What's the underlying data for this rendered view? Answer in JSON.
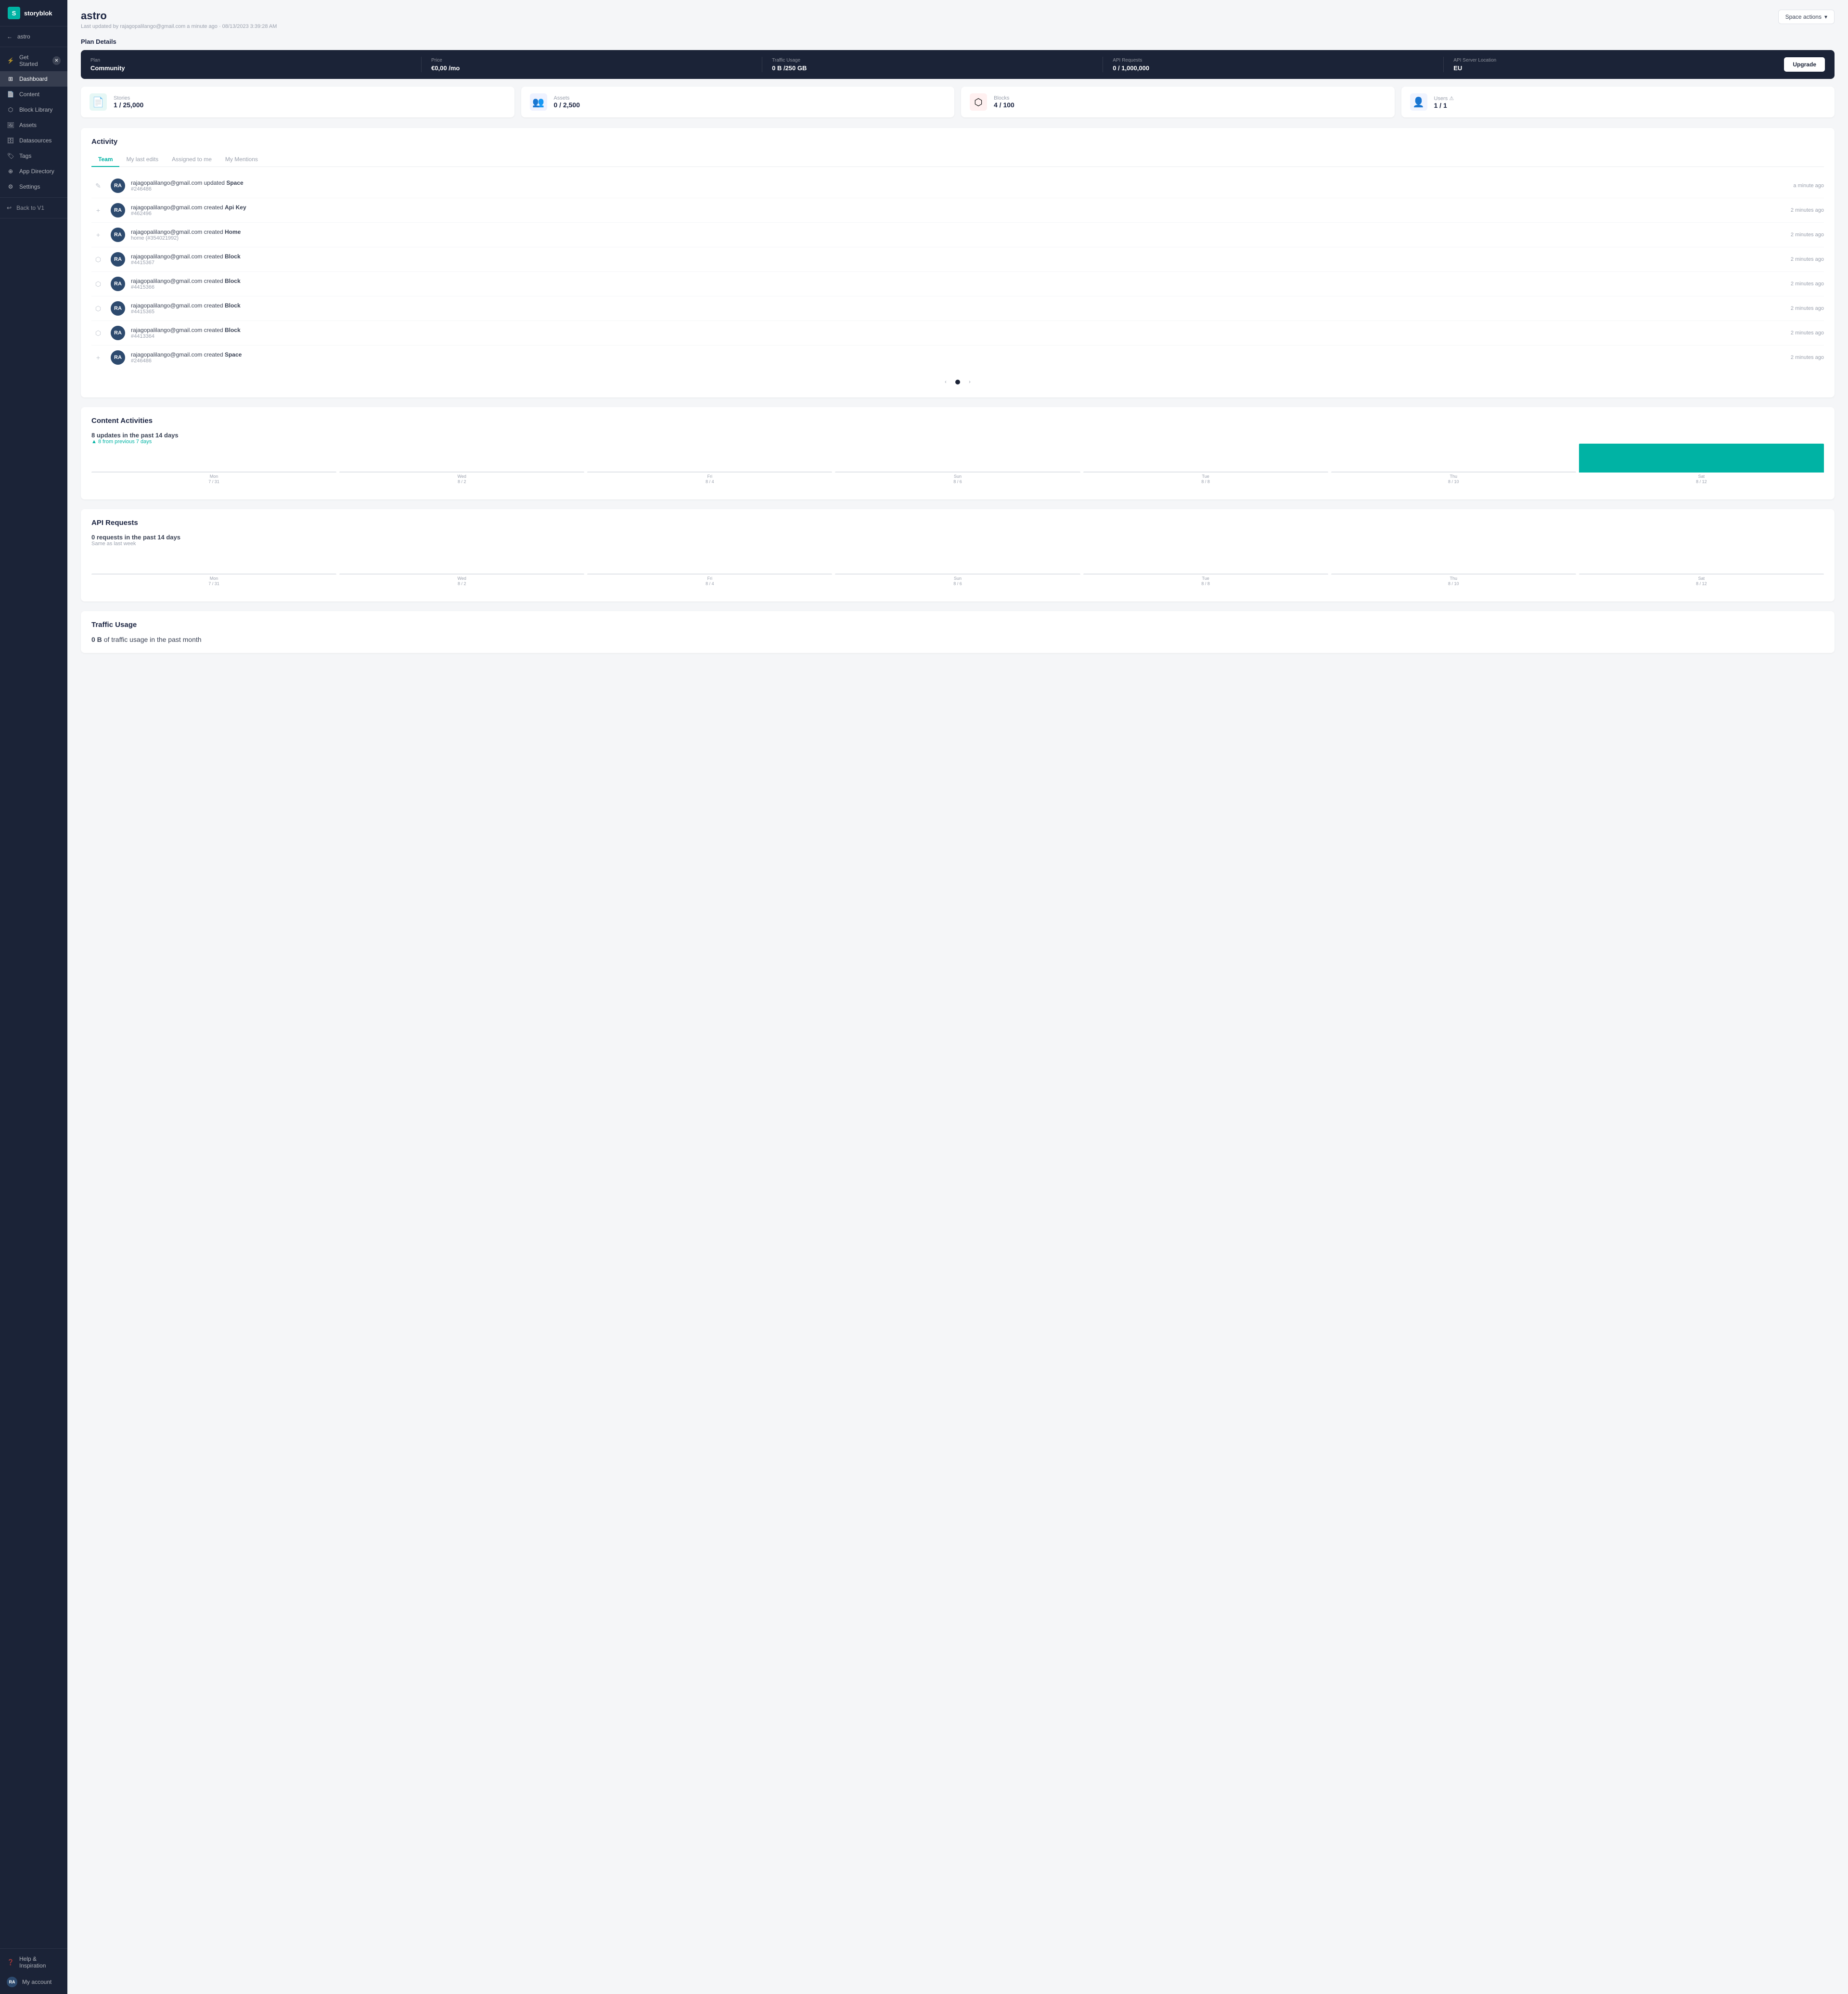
{
  "app": {
    "name": "storyblok"
  },
  "sidebar": {
    "space": "astro",
    "items": [
      {
        "id": "get-started",
        "label": "Get Started",
        "icon": "⚡",
        "active": false,
        "closeable": true
      },
      {
        "id": "dashboard",
        "label": "Dashboard",
        "icon": "🏠",
        "active": true
      },
      {
        "id": "content",
        "label": "Content",
        "icon": "📄",
        "active": false
      },
      {
        "id": "block-library",
        "label": "Block Library",
        "icon": "🧩",
        "active": false
      },
      {
        "id": "assets",
        "label": "Assets",
        "icon": "🖼",
        "active": false
      },
      {
        "id": "datasources",
        "label": "Datasources",
        "icon": "🗄",
        "active": false
      },
      {
        "id": "tags",
        "label": "Tags",
        "icon": "🏷",
        "active": false
      },
      {
        "id": "app-directory",
        "label": "App Directory",
        "icon": "📦",
        "active": false
      },
      {
        "id": "settings",
        "label": "Settings",
        "icon": "⚙",
        "active": false
      }
    ],
    "bottom_items": [
      {
        "id": "help",
        "label": "Help & Inspiration",
        "icon": "❓"
      },
      {
        "id": "account",
        "label": "My account",
        "icon": "👤",
        "initials": "RA"
      }
    ],
    "back": "Back to V1"
  },
  "header": {
    "title": "astro",
    "subtitle": "Last updated by rajagopalilango@gmail.com a minute ago · 08/13/2023 3:39:28 AM",
    "space_actions": "Space actions"
  },
  "plan": {
    "section_title": "Plan Details",
    "plan_label": "Plan",
    "plan_value": "Community",
    "price_label": "Price",
    "price_value": "€0,00 /mo",
    "traffic_label": "Traffic Usage",
    "traffic_value": "0 B /250 GB",
    "api_label": "API Requests",
    "api_value": "0 / 1,000,000",
    "location_label": "API Server Location",
    "location_value": "EU",
    "upgrade_btn": "Upgrade"
  },
  "stats": [
    {
      "id": "stories",
      "label": "Stories",
      "value": "1 / 25,000",
      "icon": "📄",
      "color": "stories"
    },
    {
      "id": "assets",
      "label": "Assets",
      "value": "0 / 2,500",
      "icon": "👤",
      "color": "assets"
    },
    {
      "id": "blocks",
      "label": "Blocks",
      "value": "4 / 100",
      "icon": "🧩",
      "color": "blocks"
    },
    {
      "id": "users",
      "label": "Users ⚠",
      "value": "1 / 1",
      "icon": "👤",
      "color": "users"
    }
  ],
  "activity": {
    "section_title": "Activity",
    "tabs": [
      "Team",
      "My last edits",
      "Assigned to me",
      "My Mentions"
    ],
    "active_tab": "Team",
    "items": [
      {
        "user": "rajagopalilango@gmail.com",
        "action": "updated",
        "object": "Space",
        "id": "#246486",
        "time": "a minute ago",
        "icon": "edit"
      },
      {
        "user": "rajagopalilango@gmail.com",
        "action": "created",
        "object": "Api Key",
        "id": "#462496",
        "time": "2 minutes ago",
        "icon": "plus"
      },
      {
        "user": "rajagopalilango@gmail.com",
        "action": "created",
        "object": "Home",
        "id": "home (#354021992)",
        "time": "2 minutes ago",
        "icon": "plus"
      },
      {
        "user": "rajagopalilango@gmail.com",
        "action": "created",
        "object": "Block",
        "id": "#4415367",
        "time": "2 minutes ago",
        "icon": "block"
      },
      {
        "user": "rajagopalilango@gmail.com",
        "action": "created",
        "object": "Block",
        "id": "#4415366",
        "time": "2 minutes ago",
        "icon": "block"
      },
      {
        "user": "rajagopalilango@gmail.com",
        "action": "created",
        "object": "Block",
        "id": "#4415365",
        "time": "2 minutes ago",
        "icon": "block"
      },
      {
        "user": "rajagopalilango@gmail.com",
        "action": "created",
        "object": "Block",
        "id": "#4413364",
        "time": "2 minutes ago",
        "icon": "block"
      },
      {
        "user": "rajagopalilango@gmail.com",
        "action": "created",
        "object": "Space",
        "id": "#246486",
        "time": "2 minutes ago",
        "icon": "plus"
      }
    ],
    "initials": "RA"
  },
  "content_activities": {
    "section_title": "Content Activities",
    "count": "8",
    "count_label": "updates in the past 14 days",
    "trend": "▲ 8 from previous 7 days",
    "chart_days": [
      {
        "label": "Mon\n7 / 31",
        "value": 0
      },
      {
        "label": "Wed\n8 / 2",
        "value": 0
      },
      {
        "label": "Fri\n8 / 4",
        "value": 0
      },
      {
        "label": "Sun\n8 / 6",
        "value": 0
      },
      {
        "label": "Tue\n8 / 8",
        "value": 0
      },
      {
        "label": "Thu\n8 / 10",
        "value": 0
      },
      {
        "label": "Sat\n8 / 12",
        "value": 8
      }
    ]
  },
  "api_requests": {
    "section_title": "API Requests",
    "count": "0",
    "count_label": "requests in the past 14 days",
    "trend": "Same as last week",
    "chart_days": [
      {
        "label": "Mon\n7 / 31",
        "value": 0
      },
      {
        "label": "Wed\n8 / 2",
        "value": 0
      },
      {
        "label": "Fri\n8 / 4",
        "value": 0
      },
      {
        "label": "Sun\n8 / 6",
        "value": 0
      },
      {
        "label": "Tue\n8 / 8",
        "value": 0
      },
      {
        "label": "Thu\n8 / 10",
        "value": 0
      },
      {
        "label": "Sat\n8 / 12",
        "value": 0
      }
    ]
  },
  "traffic_usage": {
    "section_title": "Traffic Usage",
    "value": "0 B",
    "suffix": "of traffic usage in the past month"
  }
}
